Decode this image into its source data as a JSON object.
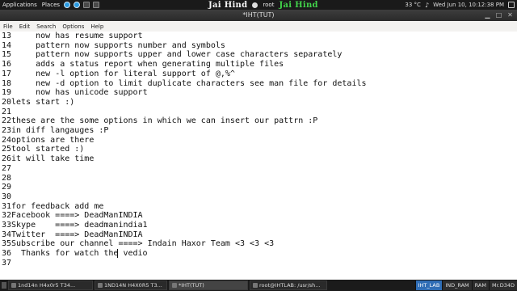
{
  "top_panel": {
    "applications": "Applications",
    "places": "Places",
    "center_left": "Jai Hind",
    "center_user": "root",
    "center_right": "Jai Hind",
    "temperature": "33 °C",
    "datetime": "Wed Jun 10, 10:12:38 PM"
  },
  "window": {
    "title": "*IHT(TUT)"
  },
  "menubar": [
    "File",
    "Edit",
    "Search",
    "Options",
    "Help"
  ],
  "editor": {
    "lines": [
      {
        "n": "13",
        "t": "    now has resume support"
      },
      {
        "n": "14",
        "t": "    pattern now supports number and symbols"
      },
      {
        "n": "15",
        "t": "    pattern now supports upper and lower case characters separately"
      },
      {
        "n": "16",
        "t": "    adds a status report when generating multiple files"
      },
      {
        "n": "17",
        "t": "    new -l option for literal support of @,%^"
      },
      {
        "n": "18",
        "t": "    new -d option to limit duplicate characters see man file for details"
      },
      {
        "n": "19",
        "t": "    now has unicode support"
      },
      {
        "n": "20",
        "t": "lets start :)"
      },
      {
        "n": "21",
        "t": ""
      },
      {
        "n": "22",
        "t": "these are the some options in which we can insert our pattrn :P"
      },
      {
        "n": "23",
        "t": "in diff langauges :P"
      },
      {
        "n": "24",
        "t": "options are there"
      },
      {
        "n": "25",
        "t": "tool started :)"
      },
      {
        "n": "26",
        "t": "it will take time"
      },
      {
        "n": "27",
        "t": ""
      },
      {
        "n": "28",
        "t": ""
      },
      {
        "n": "29",
        "t": ""
      },
      {
        "n": "30",
        "t": ""
      },
      {
        "n": "31",
        "t": "for feedback add me"
      },
      {
        "n": "32",
        "t": "Facebook ====> DeadManINDIA"
      },
      {
        "n": "33",
        "t": "Skype    ====> deadmanindia1"
      },
      {
        "n": "34",
        "t": "Twitter  ====> DeadManINDIA"
      },
      {
        "n": "35",
        "t": "Subscribe our channel ====> Indain Haxor Team <3 <3 <3"
      },
      {
        "n": "36",
        "t": "  Thanks for watch the vedio"
      },
      {
        "n": "37",
        "t": ""
      }
    ]
  },
  "taskbar": {
    "tasks": [
      "1nd14n H4x0r5 T34...",
      "1ND14N H4X0R5 T3...",
      "*IHT(TUT)",
      "root@IHTLAB: /usr/sh..."
    ],
    "workspaces": [
      "IHT_LAB",
      "IND_RAM",
      "RAM",
      "Mr.D34D"
    ]
  }
}
